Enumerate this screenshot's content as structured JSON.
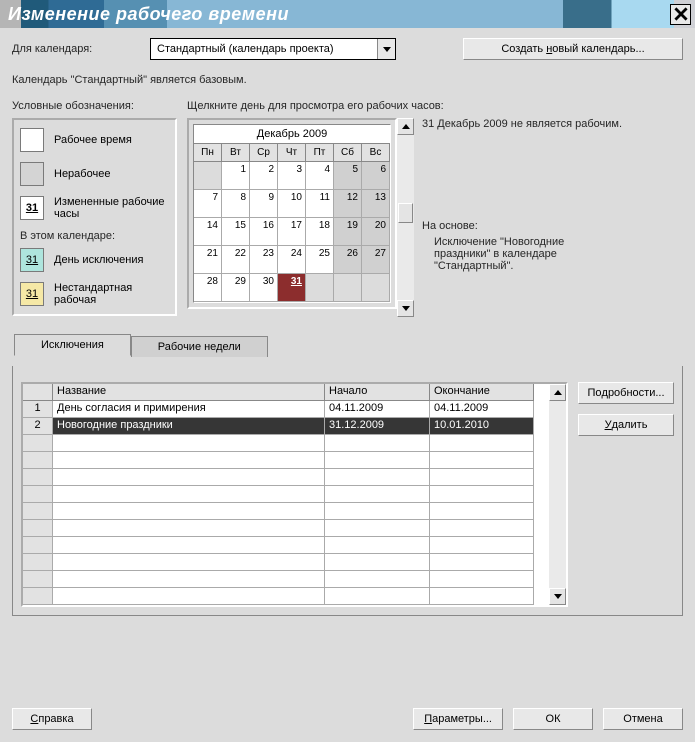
{
  "title": "Изменение рабочего времени",
  "for_calendar_label": "Для календаря:",
  "calendar_select": "Стандартный (календарь проекта)",
  "create_calendar_btn": "Создать новый календарь...",
  "base_text": "Календарь \"Стандартный\" является базовым.",
  "legend": {
    "title": "Условные обозначения:",
    "working": "Рабочее время",
    "nonworking": "Нерабочее",
    "modified": "Измененные рабочие часы",
    "modified_num": "31",
    "in_calendar": "В этом календаре:",
    "exception": "День исключения",
    "exception_num": "31",
    "nonstandard": "Нестандартная рабочая",
    "nonstandard_num": "31"
  },
  "prompt": "Щелкните день для просмотра его рабочих часов:",
  "calendar": {
    "month": "Декабрь 2009",
    "days": [
      "Пн",
      "Вт",
      "Ср",
      "Чт",
      "Пт",
      "Сб",
      "Вс"
    ]
  },
  "info": {
    "selected_text": "31 Декабрь 2009 не является рабочим.",
    "based_label": "На основе:",
    "based_text": "Исключение \"Новогодние праздники\" в календаре \"Стандартный\"."
  },
  "tabs": {
    "exceptions": "Исключения",
    "weeks": "Рабочие недели"
  },
  "grid": {
    "headers": {
      "name": "Название",
      "start": "Начало",
      "end": "Окончание"
    },
    "rows": [
      {
        "num": "1",
        "name": "День согласия и примирения",
        "start": "04.11.2009",
        "end": "04.11.2009"
      },
      {
        "num": "2",
        "name": "Новогодние праздники",
        "start": "31.12.2009",
        "end": "10.01.2010"
      }
    ]
  },
  "buttons": {
    "details": "Подробности...",
    "delete": "Удалить",
    "help": "Справка",
    "options": "Параметры...",
    "ok": "ОК",
    "cancel": "Отмена"
  },
  "chart_data": {
    "type": "table",
    "title": "Декабрь 2009",
    "columns": [
      "Пн",
      "Вт",
      "Ср",
      "Чт",
      "Пт",
      "Сб",
      "Вс"
    ],
    "rows": [
      [
        null,
        1,
        2,
        3,
        4,
        5,
        6
      ],
      [
        7,
        8,
        9,
        10,
        11,
        12,
        13
      ],
      [
        14,
        15,
        16,
        17,
        18,
        19,
        20
      ],
      [
        21,
        22,
        23,
        24,
        25,
        26,
        27
      ],
      [
        28,
        29,
        30,
        31,
        null,
        null,
        null
      ]
    ],
    "weekend_columns": [
      5,
      6
    ],
    "selected": 31
  }
}
